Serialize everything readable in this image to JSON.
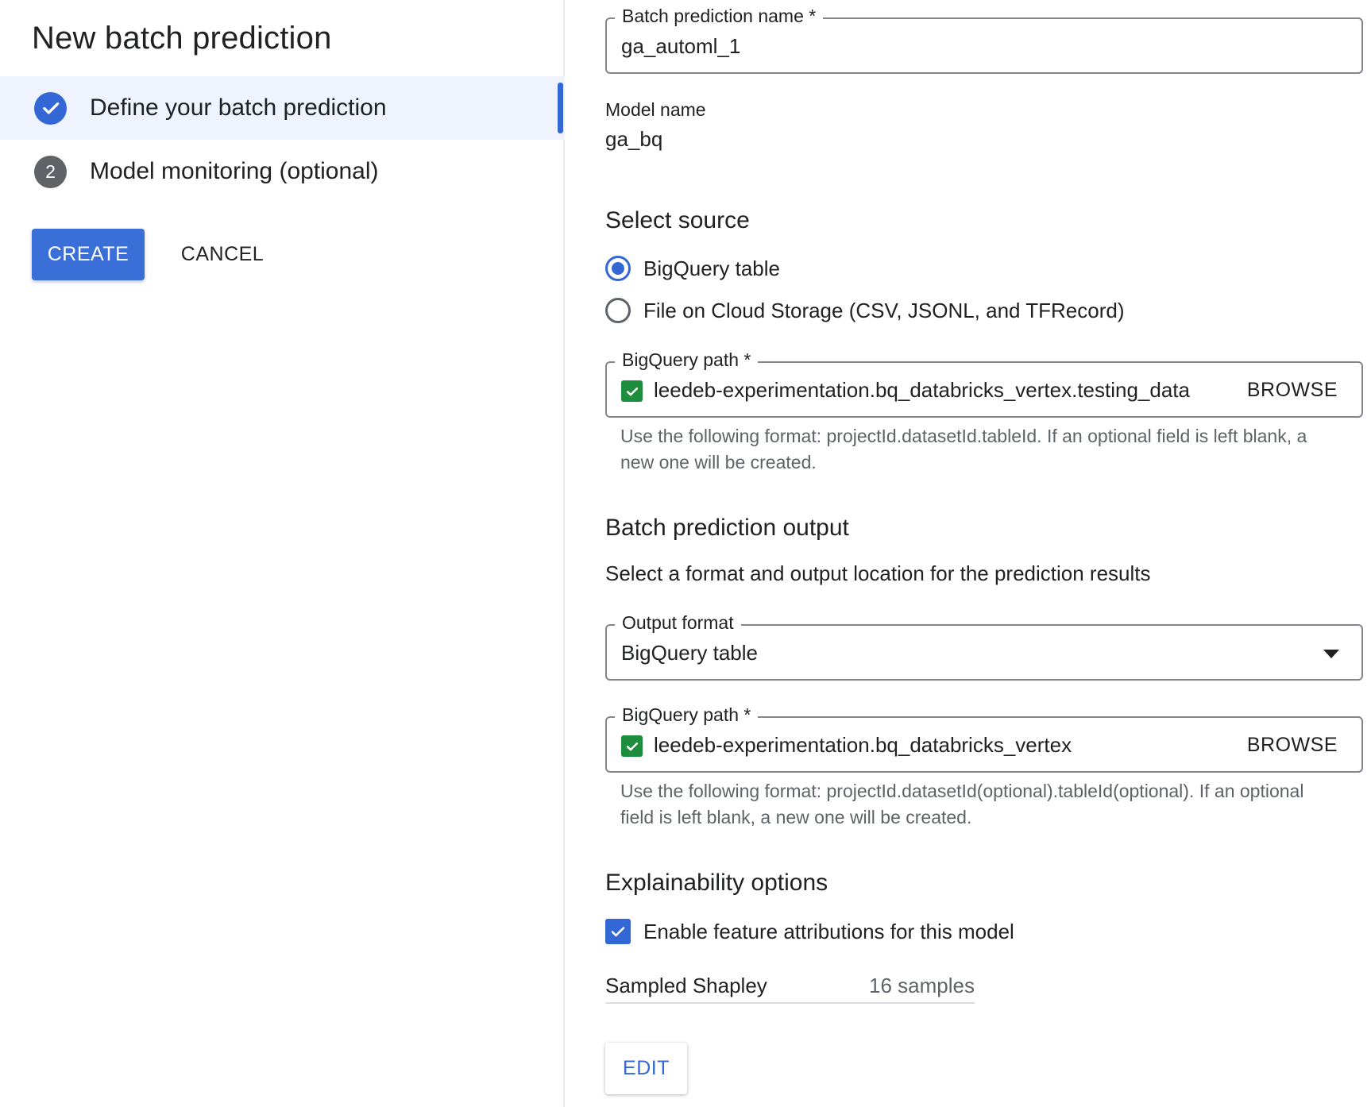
{
  "left": {
    "title": "New batch prediction",
    "steps": [
      {
        "label": "Define your batch prediction",
        "state": "done",
        "icon": "check-circle-icon"
      },
      {
        "label": "Model monitoring (optional)",
        "state": "pending",
        "number": "2"
      }
    ],
    "create_label": "CREATE",
    "cancel_label": "CANCEL"
  },
  "form": {
    "batch_name": {
      "label": "Batch prediction name *",
      "value": "ga_automl_1"
    },
    "model": {
      "label": "Model name",
      "value": "ga_bq"
    },
    "source": {
      "title": "Select source",
      "options": [
        {
          "label": "BigQuery table",
          "checked": true
        },
        {
          "label": "File on Cloud Storage (CSV, JSONL, and TFRecord)",
          "checked": false
        }
      ],
      "bq_path": {
        "label": "BigQuery path *",
        "value": "leedeb-experimentation.bq_databricks_vertex.testing_data",
        "browse": "BROWSE",
        "hint": "Use the following format: projectId.datasetId.tableId. If an optional field is left blank, a new one will be created."
      }
    },
    "output": {
      "title": "Batch prediction output",
      "description": "Select a format and output location for the prediction results",
      "format": {
        "label": "Output format",
        "value": "BigQuery table"
      },
      "bq_path": {
        "label": "BigQuery path *",
        "value": "leedeb-experimentation.bq_databricks_vertex",
        "browse": "BROWSE",
        "hint": "Use the following format: projectId.datasetId(optional).tableId(optional). If an optional field is left blank, a new one will be created."
      }
    },
    "explain": {
      "title": "Explainability options",
      "checkbox_label": "Enable feature attributions for this model",
      "checked": true,
      "method_name": "Sampled Shapley",
      "method_value": "16 samples",
      "edit_label": "EDIT"
    }
  },
  "colors": {
    "accent": "#3367d6",
    "success": "#1e8e3e",
    "active_step_bg": "#eef3fd",
    "hint_text": "#5f6368"
  }
}
